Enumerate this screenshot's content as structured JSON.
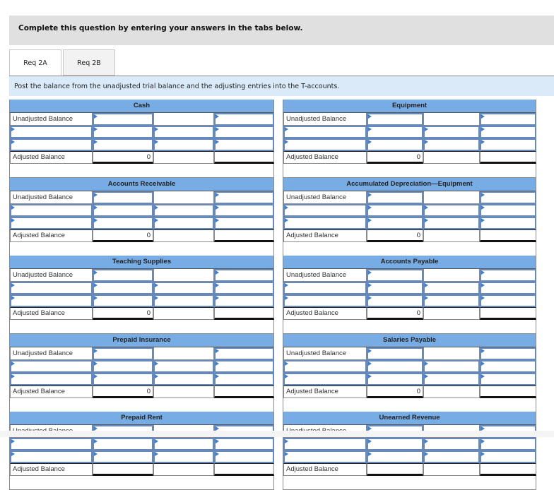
{
  "instruction": "Complete this question by entering your answers in the tabs below.",
  "tabs": [
    {
      "label": "Req 2A",
      "active": true
    },
    {
      "label": "Req 2B",
      "active": false
    }
  ],
  "prompt": "Post the balance from the unadjusted trial balance and the adjusting entries into the T-accounts.",
  "row_labels": {
    "unadjusted": "Unadjusted Balance",
    "adjusted": "Adjusted Balance"
  },
  "accounts_left": [
    {
      "title": "Cash",
      "adjusted_value": "0"
    },
    {
      "title": "Accounts Receivable",
      "adjusted_value": "0"
    },
    {
      "title": "Teaching Supplies",
      "adjusted_value": "0"
    },
    {
      "title": "Prepaid Insurance",
      "adjusted_value": "0"
    },
    {
      "title": "Prepaid Rent",
      "adjusted_value": ""
    }
  ],
  "accounts_right": [
    {
      "title": "Equipment",
      "adjusted_value": "0"
    },
    {
      "title": "Accumulated Depreciation—Equipment",
      "adjusted_value": "0"
    },
    {
      "title": "Accounts Payable",
      "adjusted_value": "0"
    },
    {
      "title": "Salaries Payable",
      "adjusted_value": "0"
    },
    {
      "title": "Unearned Revenue",
      "adjusted_value": ""
    }
  ],
  "colors": {
    "header_blue": "#78ace4",
    "prompt_bg": "#dbeaf8",
    "instruction_bg": "#e0e0e0",
    "input_marker": "#3d7fd0"
  }
}
